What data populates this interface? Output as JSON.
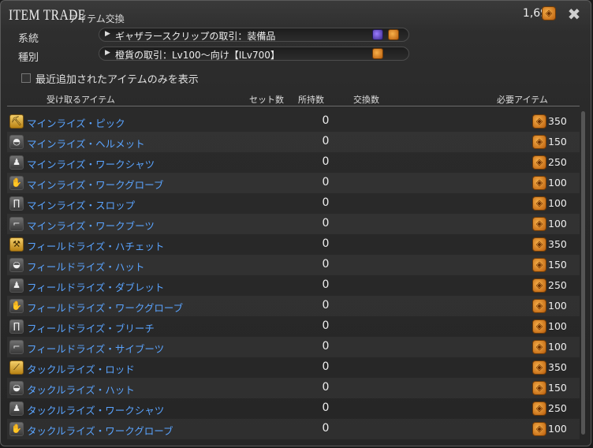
{
  "window": {
    "title": "ITEM TRADE",
    "subtitle": "アイテム交換",
    "currency_amount": "1,697"
  },
  "filters": {
    "category_label": "系統",
    "category_value": "ギャザラースクリップの取引：装備品",
    "type_label": "種別",
    "type_value": "橙貨の取引：Lv100〜向け【ILv700】",
    "recent_only_label": "最近追加されたアイテムのみを表示",
    "recent_only_checked": false
  },
  "columns": {
    "item": "受け取るアイテム",
    "sets": "セット数",
    "owned": "所持数",
    "trade": "交換数",
    "required": "必要アイテム"
  },
  "items": [
    {
      "name": "マインライズ・ピック",
      "owned": "0",
      "cost": "350",
      "icon": "pickaxe-icon"
    },
    {
      "name": "マインライズ・ヘルメット",
      "owned": "0",
      "cost": "150",
      "icon": "helmet-icon"
    },
    {
      "name": "マインライズ・ワークシャツ",
      "owned": "0",
      "cost": "250",
      "icon": "shirt-icon"
    },
    {
      "name": "マインライズ・ワークグローブ",
      "owned": "0",
      "cost": "100",
      "icon": "glove-icon"
    },
    {
      "name": "マインライズ・スロップ",
      "owned": "0",
      "cost": "100",
      "icon": "trousers-icon"
    },
    {
      "name": "マインライズ・ワークブーツ",
      "owned": "0",
      "cost": "100",
      "icon": "boots-icon"
    },
    {
      "name": "フィールドライズ・ハチェット",
      "owned": "0",
      "cost": "350",
      "icon": "hatchet-icon"
    },
    {
      "name": "フィールドライズ・ハット",
      "owned": "0",
      "cost": "150",
      "icon": "hat-icon"
    },
    {
      "name": "フィールドライズ・ダブレット",
      "owned": "0",
      "cost": "250",
      "icon": "doublet-icon"
    },
    {
      "name": "フィールドライズ・ワークグローブ",
      "owned": "0",
      "cost": "100",
      "icon": "glove-icon"
    },
    {
      "name": "フィールドライズ・ブリーチ",
      "owned": "0",
      "cost": "100",
      "icon": "trousers-icon"
    },
    {
      "name": "フィールドライズ・サイブーツ",
      "owned": "0",
      "cost": "100",
      "icon": "boots-icon"
    },
    {
      "name": "タックルライズ・ロッド",
      "owned": "0",
      "cost": "350",
      "icon": "rod-icon"
    },
    {
      "name": "タックルライズ・ハット",
      "owned": "0",
      "cost": "150",
      "icon": "hat-icon"
    },
    {
      "name": "タックルライズ・ワークシャツ",
      "owned": "0",
      "cost": "250",
      "icon": "shirt-icon"
    },
    {
      "name": "タックルライズ・ワークグローブ",
      "owned": "0",
      "cost": "100",
      "icon": "glove-icon"
    }
  ]
}
